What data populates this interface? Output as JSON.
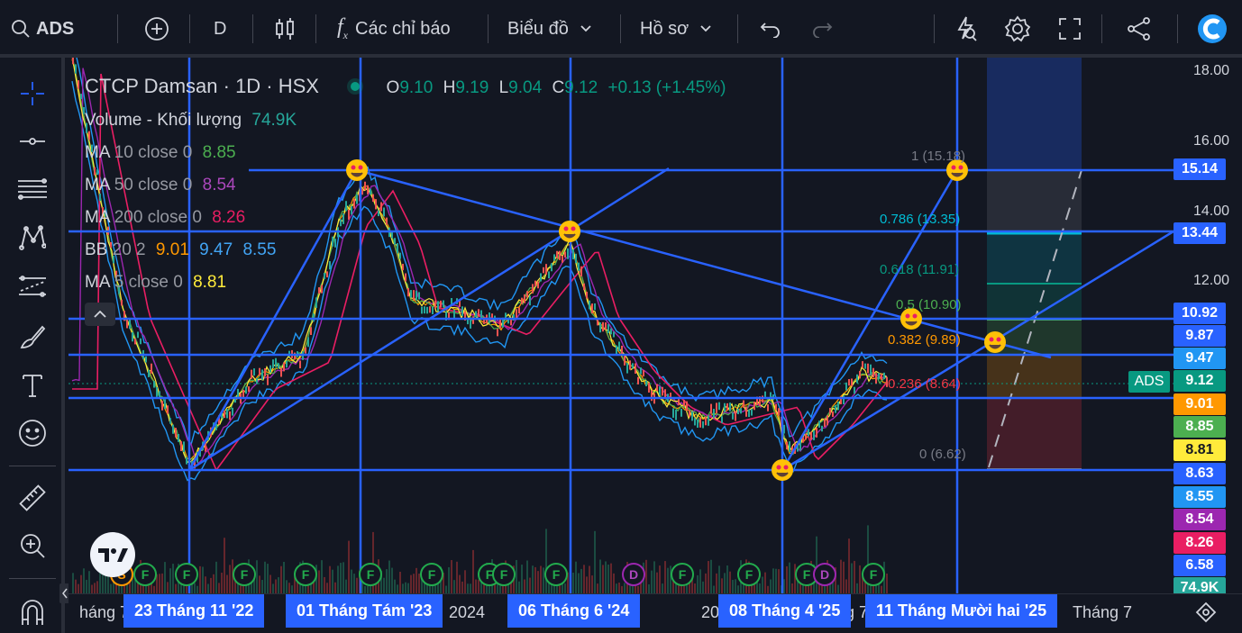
{
  "toolbar": {
    "symbol": "ADS",
    "interval": "D",
    "indicators_label": "Các chỉ báo",
    "chart_type_label": "Biểu đồ",
    "profile_label": "Hồ sơ"
  },
  "legend": {
    "title": "CTCP Damsan · 1D · HSX",
    "ohlc": {
      "o_label": "O",
      "o": "9.10",
      "h_label": "H",
      "h": "9.19",
      "l_label": "L",
      "l": "9.04",
      "c_label": "C",
      "c": "9.12",
      "change": "+0.13 (+1.45%)"
    },
    "volume": {
      "name": "Volume - Khối lượng",
      "value": "74.9K"
    },
    "ma10": {
      "name": "MA",
      "params": "10 close 0",
      "value": "8.85",
      "color": "#4caf50"
    },
    "ma50": {
      "name": "MA",
      "params": "50 close 0",
      "value": "8.54",
      "color": "#9c27b0"
    },
    "ma200": {
      "name": "MA",
      "params": "200 close 0",
      "value": "8.26",
      "color": "#e91e63"
    },
    "bb": {
      "name": "BB",
      "params": "20 2",
      "basis": "9.01",
      "upper": "9.47",
      "lower": "8.55"
    },
    "ma5": {
      "name": "MA",
      "params": "5 close 0",
      "value": "8.81",
      "color": "#ffeb3b"
    }
  },
  "price_axis": {
    "ticks": [
      "18.00",
      "16.00",
      "14.00",
      "12.00"
    ],
    "tags": [
      {
        "value": "15.14",
        "bg": "#2962ff",
        "fg": "#ffffff"
      },
      {
        "value": "13.44",
        "bg": "#2962ff",
        "fg": "#ffffff"
      },
      {
        "value": "10.92",
        "bg": "#2962ff",
        "fg": "#ffffff"
      },
      {
        "value": "9.87",
        "bg": "#2962ff",
        "fg": "#ffffff"
      },
      {
        "value": "9.47",
        "bg": "#2196f3",
        "fg": "#ffffff"
      },
      {
        "value": "9.12",
        "bg": "#089981",
        "fg": "#ffffff"
      },
      {
        "value": "9.01",
        "bg": "#ff9800",
        "fg": "#ffffff"
      },
      {
        "value": "8.85",
        "bg": "#4caf50",
        "fg": "#ffffff"
      },
      {
        "value": "8.81",
        "bg": "#ffeb3b",
        "fg": "#131722"
      },
      {
        "value": "8.63",
        "bg": "#2962ff",
        "fg": "#ffffff"
      },
      {
        "value": "8.55",
        "bg": "#2196f3",
        "fg": "#ffffff"
      },
      {
        "value": "8.54",
        "bg": "#9c27b0",
        "fg": "#ffffff"
      },
      {
        "value": "8.26",
        "bg": "#e91e63",
        "fg": "#ffffff"
      },
      {
        "value": "6.58",
        "bg": "#2962ff",
        "fg": "#ffffff"
      },
      {
        "value": "74.9K",
        "bg": "#26a69a",
        "fg": "#ffffff"
      }
    ],
    "symbol_tag": "ADS"
  },
  "fib_levels": [
    {
      "label": "1 (15.18)",
      "color": "#787b86"
    },
    {
      "label": "0.786 (13.35)",
      "color": "#00bcd4"
    },
    {
      "label": "0.618 (11.91)",
      "color": "#089981"
    },
    {
      "label": "0.5 (10.90)",
      "color": "#4caf50"
    },
    {
      "label": "0.382 (9.89)",
      "color": "#ff9800"
    },
    {
      "label": "0.236 (8.64)",
      "color": "#f23645"
    },
    {
      "label": "0 (6.62)",
      "color": "#787b86"
    }
  ],
  "time_axis": {
    "labels": [
      "háng 7",
      "2024",
      "20",
      "g 7",
      "Tháng 7"
    ],
    "tags": [
      "23 Tháng 11 '22",
      "01 Tháng Tám '23",
      "06 Tháng 6 '24",
      "08 Tháng 4 '25",
      "11 Tháng Mười hai '25"
    ]
  },
  "events": [
    "S",
    "F",
    "F",
    "F",
    "F",
    "F",
    "F",
    "F",
    "F",
    "F",
    "D",
    "F",
    "F",
    "F",
    "D",
    "F"
  ]
}
